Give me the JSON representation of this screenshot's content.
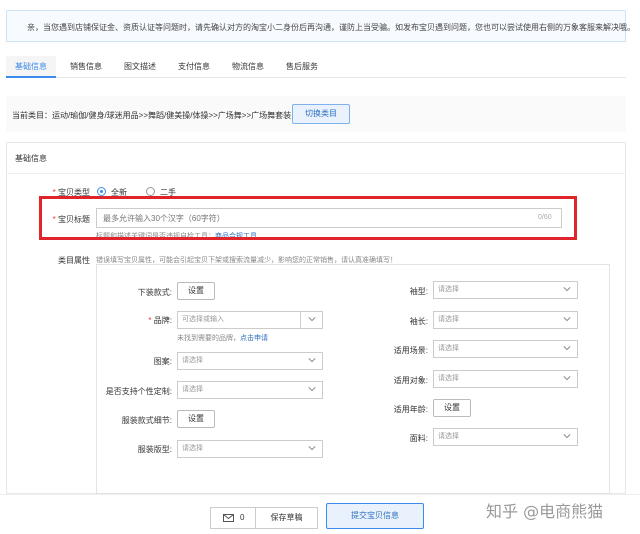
{
  "notice": {
    "text": "亲，当您遇到店铺保证金、资质认证等问题时，请先确认对方的淘宝小二身份后再沟通，谨防上当受骗。如发布宝贝遇到问题，您也可以尝试使用右侧的万象客服来解决哦。"
  },
  "tabs": [
    {
      "label": "基础信息",
      "active": true
    },
    {
      "label": "销售信息",
      "active": false
    },
    {
      "label": "图文描述",
      "active": false
    },
    {
      "label": "支付信息",
      "active": false
    },
    {
      "label": "物流信息",
      "active": false
    },
    {
      "label": "售后服务",
      "active": false
    }
  ],
  "category": {
    "current": "当前类目：运动/瑜伽/健身/球迷用品>>舞蹈/健美操/体操>>广场舞>>广场舞套装",
    "switch_label": "切换类目"
  },
  "basic": {
    "section_title": "基础信息",
    "type_label": "宝贝类型",
    "type_options": [
      "全新",
      "二手"
    ],
    "title_label": "宝贝标题",
    "title_placeholder": "最多允许输入30个汉字（60字符）",
    "title_counter": "0/60",
    "title_hint": "标题和描述关键词是否违规自检工具：",
    "title_hint_link": "商品合规工具",
    "attr_label": "类目属性",
    "attr_hint": "错误填写宝贝属性，可能会引起宝贝下架或搜索流量减少，影响您的正常销售，请认真准确填写！"
  },
  "attributes": {
    "left": [
      {
        "label": "下装款式:",
        "kind": "button",
        "value": "设置",
        "required": false
      },
      {
        "label": "品牌:",
        "kind": "input",
        "value": "可选择或输入",
        "required": true,
        "note": "未找到需要的品牌，",
        "note_link": "点击申请"
      },
      {
        "label": "图案:",
        "kind": "select",
        "value": "请选择",
        "required": false
      },
      {
        "label": "是否支持个性定制:",
        "kind": "select",
        "value": "请选择",
        "required": false
      },
      {
        "label": "服装款式细节:",
        "kind": "button",
        "value": "设置",
        "required": false
      },
      {
        "label": "服装版型:",
        "kind": "select",
        "value": "请选择",
        "required": false
      }
    ],
    "right": [
      {
        "label": "袖型:",
        "kind": "select",
        "value": "请选择"
      },
      {
        "label": "袖长:",
        "kind": "select",
        "value": "请选择"
      },
      {
        "label": "适用场景:",
        "kind": "select",
        "value": "请选择"
      },
      {
        "label": "适用对象:",
        "kind": "select",
        "value": "请选择"
      },
      {
        "label": "适用年龄:",
        "kind": "button",
        "value": "设置"
      },
      {
        "label": "面料:",
        "kind": "select",
        "value": "请选择"
      }
    ]
  },
  "footer": {
    "mail_count": "0",
    "save_draft": "保存草稿",
    "submit": "提交宝贝信息"
  },
  "watermark": "知乎 @电商熊猫",
  "colors": {
    "accent": "#3b8bea",
    "highlight_box": "#e0242b",
    "required": "#ee3333"
  }
}
